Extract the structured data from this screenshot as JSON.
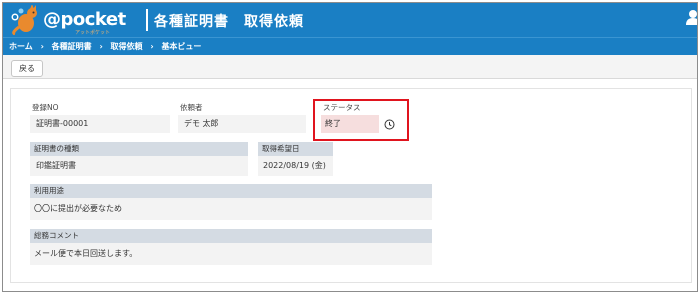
{
  "header": {
    "logo_text": "@pocket",
    "logo_sub": "アットポケット",
    "title": "各種証明書　取得依頼"
  },
  "breadcrumb": {
    "items": [
      "ホーム",
      "各種証明書",
      "取得依頼",
      "基本ビュー"
    ],
    "separator": "›"
  },
  "toolbar": {
    "back_label": "戻る"
  },
  "form": {
    "registration_no": {
      "label": "登録NO",
      "value": "証明書-00001"
    },
    "requester": {
      "label": "依頼者",
      "value": "デモ 太郎"
    },
    "status": {
      "label": "ステータス",
      "value": "終了"
    },
    "certificate_type": {
      "label": "証明書の種類",
      "value": "印鑑証明書"
    },
    "desired_date": {
      "label": "取得希望日",
      "value": "2022/08/19 (金)"
    },
    "purpose": {
      "label": "利用用途",
      "value": "〇〇に提出が必要なため"
    },
    "general_comment": {
      "label": "総務コメント",
      "value": "メール便で本日回送します。"
    }
  },
  "colors": {
    "header_blue": "#1a7fc4",
    "highlight_red": "#e0141e",
    "status_bg": "#f6dede",
    "section_head": "#d4dbe3"
  }
}
